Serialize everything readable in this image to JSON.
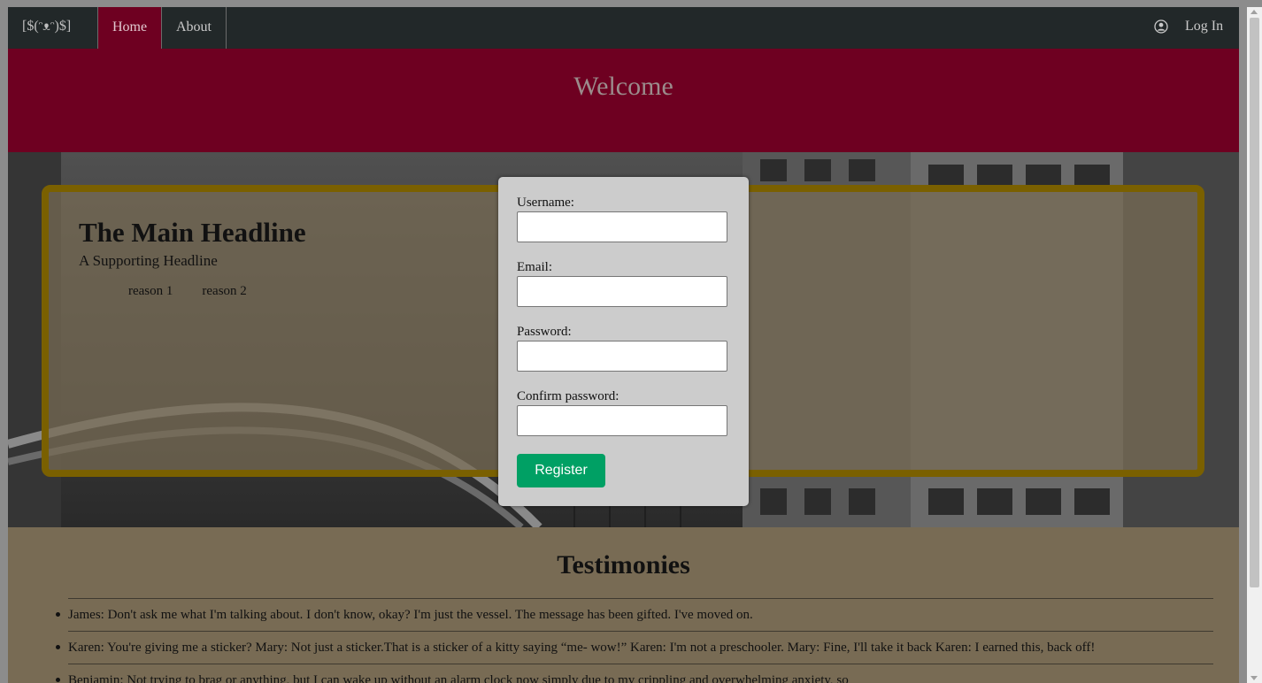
{
  "navbar": {
    "brand": "[$(ᵔᴥᵔ)$]",
    "home_label": "Home",
    "about_label": "About",
    "login_label": "Log In"
  },
  "banner": {
    "title": "Welcome"
  },
  "hero": {
    "headline": "The Main Headline",
    "subheadline": "A Supporting Headline",
    "reasons": [
      "reason 1",
      "reason 2"
    ]
  },
  "form": {
    "username_label": "Username:",
    "username_value": "",
    "email_label": "Email:",
    "email_value": "",
    "password_label": "Password:",
    "password_value": "",
    "confirm_label": "Confirm password:",
    "confirm_value": "",
    "register_label": "Register"
  },
  "testimonies": {
    "title": "Testimonies",
    "items": [
      "James: Don't ask me what I'm talking about. I don't know, okay? I'm just the vessel. The message has been gifted. I've moved on.",
      "Karen: You're giving me a sticker? Mary: Not just a sticker.That is a sticker of a kitty saying “me- wow!” Karen: I'm not a preschooler. Mary: Fine, I'll take it back Karen: I earned this, back off!",
      "Benjamin: Not trying to brag or anything, but I can wake up without an alarm clock now simply due to my crippling and overwhelming anxiety, so"
    ]
  },
  "colors": {
    "navbar_bg": "#222829",
    "accent_maroon": "#6e0021",
    "panel_border": "#7a6000",
    "register_green": "#00a064",
    "testimonies_bg": "#786b54"
  }
}
